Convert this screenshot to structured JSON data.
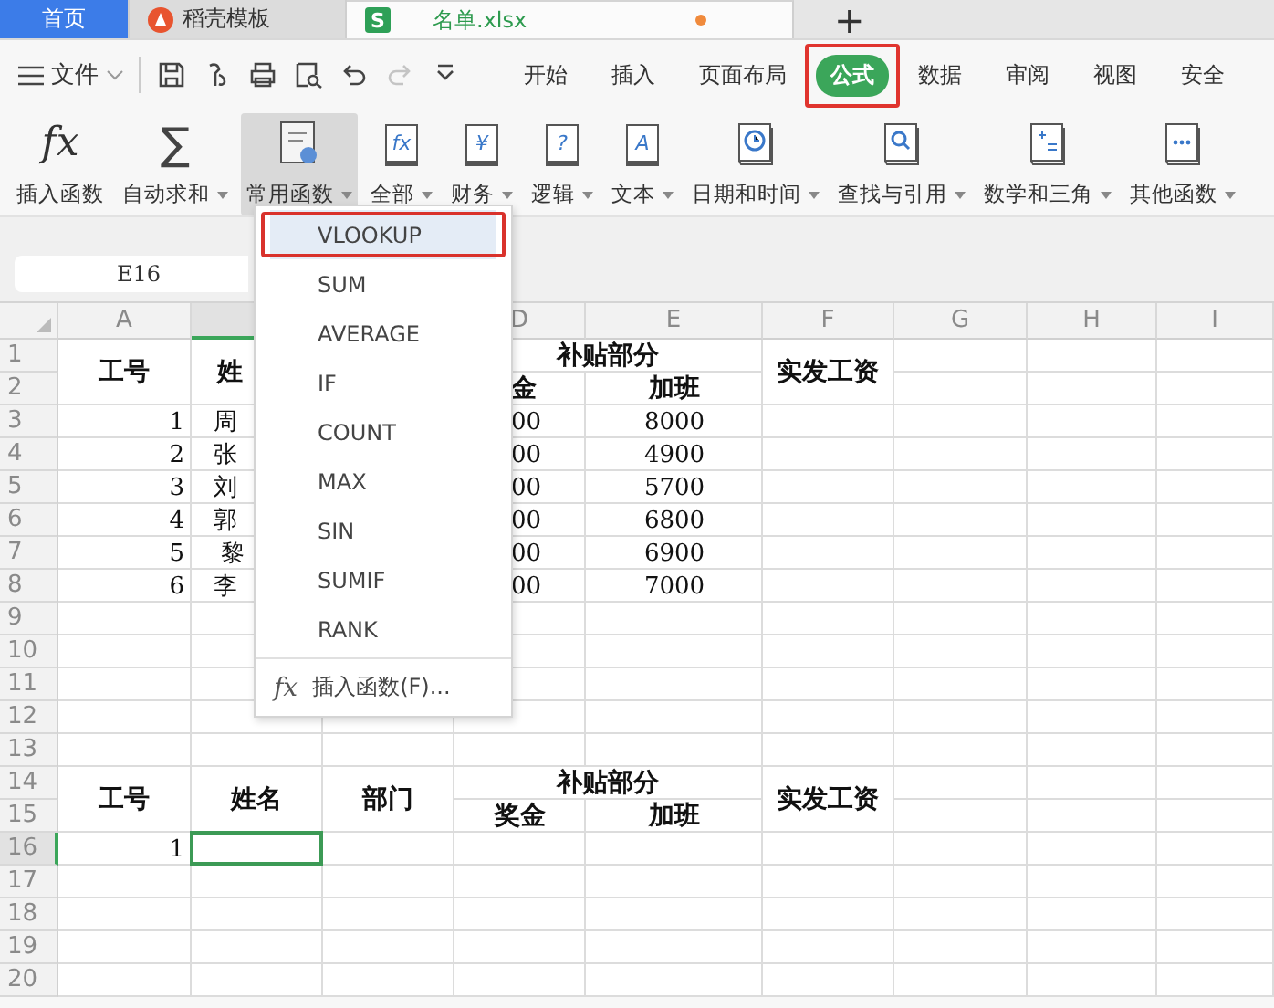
{
  "doc_tabs": [
    {
      "kind": "home",
      "label": "首页",
      "selected": false
    },
    {
      "kind": "template",
      "label": "稻壳模板",
      "selected": false
    },
    {
      "kind": "sheet",
      "label": "名单.xlsx",
      "icon_text": "S",
      "selected": true,
      "unsaved": true
    }
  ],
  "new_tab": "+",
  "menu": {
    "file": "文件",
    "quick_tools": [
      {
        "kind": "save",
        "disabled": false
      },
      {
        "kind": "brush",
        "disabled": false
      },
      {
        "kind": "print",
        "disabled": false
      },
      {
        "kind": "preview",
        "disabled": false
      },
      {
        "kind": "undo",
        "disabled": false
      },
      {
        "kind": "redo",
        "disabled": true
      },
      {
        "kind": "more",
        "disabled": false
      }
    ],
    "tabs": [
      {
        "label": "开始",
        "selected": false,
        "annotated": false
      },
      {
        "label": "插入",
        "selected": false,
        "annotated": false
      },
      {
        "label": "页面布局",
        "selected": false,
        "annotated": false
      },
      {
        "label": "公式",
        "selected": true,
        "annotated": true
      },
      {
        "label": "数据",
        "selected": false,
        "annotated": false
      },
      {
        "label": "审阅",
        "selected": false,
        "annotated": false
      },
      {
        "label": "视图",
        "selected": false,
        "annotated": false
      },
      {
        "label": "安全",
        "selected": false,
        "annotated": false
      }
    ]
  },
  "ribbon": [
    {
      "kind": "fx",
      "icon_text": "fx",
      "label": "插入函数",
      "has_menu": false,
      "selected": false
    },
    {
      "kind": "sigma",
      "icon_text": "∑",
      "label": "自动求和",
      "has_menu": true,
      "selected": false
    },
    {
      "kind": "common",
      "label": "常用函数",
      "has_menu": true,
      "selected": true
    },
    {
      "kind": "book",
      "icon_text": "fx",
      "label": "全部",
      "has_menu": true,
      "selected": false
    },
    {
      "kind": "book",
      "icon_text": "¥",
      "label": "财务",
      "has_menu": true,
      "selected": false
    },
    {
      "kind": "book",
      "icon_text": "?",
      "label": "逻辑",
      "has_menu": true,
      "selected": false
    },
    {
      "kind": "book",
      "icon_text": "A",
      "label": "文本",
      "has_menu": true,
      "selected": false
    },
    {
      "kind": "book-clock",
      "label": "日期和时间",
      "has_menu": true,
      "selected": false
    },
    {
      "kind": "book-search",
      "label": "查找与引用",
      "has_menu": true,
      "selected": false
    },
    {
      "kind": "book-math",
      "label": "数学和三角",
      "has_menu": true,
      "selected": false
    },
    {
      "kind": "book-dots",
      "label": "其他函数",
      "has_menu": true,
      "selected": false
    }
  ],
  "name_box": "E16",
  "function_menu": {
    "items": [
      {
        "kind": "function",
        "label": "VLOOKUP",
        "selected": true,
        "annotated": true
      },
      {
        "kind": "function",
        "label": "SUM",
        "selected": false,
        "annotated": false
      },
      {
        "kind": "function",
        "label": "AVERAGE",
        "selected": false,
        "annotated": false
      },
      {
        "kind": "function",
        "label": "IF",
        "selected": false,
        "annotated": false
      },
      {
        "kind": "function",
        "label": "COUNT",
        "selected": false,
        "annotated": false
      },
      {
        "kind": "function",
        "label": "MAX",
        "selected": false,
        "annotated": false
      },
      {
        "kind": "function",
        "label": "SIN",
        "selected": false,
        "annotated": false
      },
      {
        "kind": "function",
        "label": "SUMIF",
        "selected": false,
        "annotated": false
      },
      {
        "kind": "function",
        "label": "RANK",
        "selected": false,
        "annotated": false
      },
      {
        "kind": "insert",
        "icon_text": "fx",
        "label": "插入函数(F)...",
        "selected": false,
        "annotated": false
      }
    ]
  },
  "sheet": {
    "columns": [
      {
        "kind": "letter",
        "label": "A"
      },
      {
        "kind": "covered"
      },
      {
        "kind": "covered"
      },
      {
        "kind": "letter",
        "label": "D"
      },
      {
        "kind": "letter",
        "label": "E"
      },
      {
        "kind": "letter",
        "label": "F"
      },
      {
        "kind": "letter",
        "label": "G"
      },
      {
        "kind": "letter",
        "label": "H"
      },
      {
        "kind": "letter",
        "label": "I"
      }
    ],
    "rows": [
      {
        "label": "1",
        "selected": false,
        "cells": [
          {
            "kind": "header",
            "text": "工号",
            "merge_down": true,
            "selected": false
          },
          {
            "kind": "header-left",
            "text": "姓",
            "merge_down": true,
            "selected": false
          },
          {
            "kind": "empty"
          },
          {
            "kind": "header",
            "text": "补贴部分",
            "merge_across": true,
            "selected": false
          },
          {
            "kind": "empty"
          },
          {
            "kind": "header",
            "text": "实发工资",
            "merge_down": true,
            "selected": false
          }
        ]
      },
      {
        "label": "2",
        "selected": false,
        "cells": [
          {
            "kind": "empty"
          },
          {
            "kind": "empty"
          },
          {
            "kind": "empty"
          },
          {
            "kind": "header-clipped",
            "text": "金",
            "selected": false
          },
          {
            "kind": "header",
            "text": "加班",
            "selected": false
          }
        ]
      },
      {
        "label": "3",
        "selected": false,
        "cells": [
          {
            "kind": "number",
            "text": "1",
            "selected": false
          },
          {
            "kind": "text",
            "text": "周",
            "selected": false
          },
          {
            "kind": "empty"
          },
          {
            "kind": "clipped",
            "text": "00",
            "selected": false
          },
          {
            "kind": "value",
            "text": "8000",
            "selected": false
          }
        ]
      },
      {
        "label": "4",
        "selected": false,
        "cells": [
          {
            "kind": "number",
            "text": "2",
            "selected": false
          },
          {
            "kind": "text",
            "text": "张",
            "selected": false
          },
          {
            "kind": "empty"
          },
          {
            "kind": "clipped",
            "text": "00",
            "selected": false
          },
          {
            "kind": "value",
            "text": "4900",
            "selected": false
          }
        ]
      },
      {
        "label": "5",
        "selected": false,
        "cells": [
          {
            "kind": "number",
            "text": "3",
            "selected": false
          },
          {
            "kind": "text",
            "text": "刘",
            "selected": false
          },
          {
            "kind": "empty"
          },
          {
            "kind": "clipped",
            "text": "00",
            "selected": false
          },
          {
            "kind": "value",
            "text": "5700",
            "selected": false
          }
        ]
      },
      {
        "label": "6",
        "selected": false,
        "cells": [
          {
            "kind": "number",
            "text": "4",
            "selected": false
          },
          {
            "kind": "text",
            "text": "郭",
            "selected": false
          },
          {
            "kind": "empty"
          },
          {
            "kind": "clipped",
            "text": "00",
            "selected": false
          },
          {
            "kind": "value",
            "text": "6800",
            "selected": false
          }
        ]
      },
      {
        "label": "7",
        "selected": false,
        "cells": [
          {
            "kind": "number",
            "text": "5",
            "selected": false
          },
          {
            "kind": "text-indent",
            "text": "黎",
            "selected": false
          },
          {
            "kind": "empty"
          },
          {
            "kind": "clipped",
            "text": "00",
            "selected": false
          },
          {
            "kind": "value",
            "text": "6900",
            "selected": false
          }
        ]
      },
      {
        "label": "8",
        "selected": false,
        "cells": [
          {
            "kind": "number",
            "text": "6",
            "selected": false
          },
          {
            "kind": "text",
            "text": "李",
            "selected": false
          },
          {
            "kind": "empty"
          },
          {
            "kind": "clipped",
            "text": "00",
            "selected": false
          },
          {
            "kind": "value",
            "text": "7000",
            "selected": false
          }
        ]
      },
      {
        "label": "9",
        "selected": false
      },
      {
        "label": "10",
        "selected": false
      },
      {
        "label": "11",
        "selected": false
      },
      {
        "label": "12",
        "selected": false
      },
      {
        "label": "13",
        "selected": false
      },
      {
        "label": "14",
        "selected": false,
        "cells": [
          {
            "kind": "header",
            "text": "工号",
            "merge_down": true,
            "selected": false
          },
          {
            "kind": "header",
            "text": "姓名",
            "merge_down": true,
            "selected": false
          },
          {
            "kind": "header",
            "text": "部门",
            "merge_down": true,
            "selected": false
          },
          {
            "kind": "header",
            "text": "补贴部分",
            "merge_across": true,
            "selected": false
          },
          {
            "kind": "empty"
          },
          {
            "kind": "header",
            "text": "实发工资",
            "merge_down": true,
            "selected": false
          }
        ]
      },
      {
        "label": "15",
        "selected": false,
        "cells": [
          {
            "kind": "empty"
          },
          {
            "kind": "empty"
          },
          {
            "kind": "empty"
          },
          {
            "kind": "header",
            "text": "奖金",
            "selected": false
          },
          {
            "kind": "header",
            "text": "加班",
            "selected": false
          }
        ]
      },
      {
        "label": "16",
        "selected": true,
        "cells": [
          {
            "kind": "number",
            "text": "1",
            "selected": false
          },
          {
            "kind": "empty",
            "selected": true
          }
        ]
      },
      {
        "label": "17",
        "selected": false
      },
      {
        "label": "18",
        "selected": false
      },
      {
        "label": "19",
        "selected": false
      },
      {
        "label": "20",
        "selected": false
      }
    ]
  }
}
